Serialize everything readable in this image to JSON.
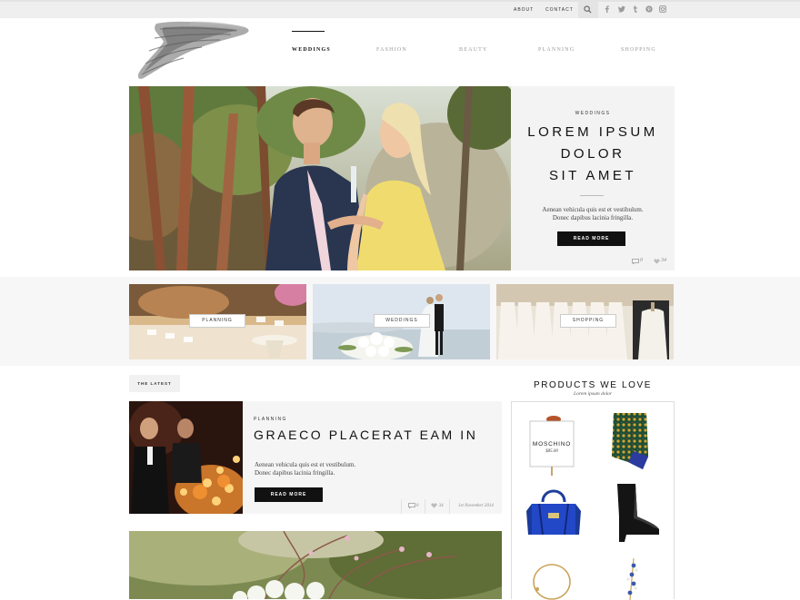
{
  "topbar": {
    "links": [
      "ABOUT",
      "CONTACT"
    ],
    "search_icon": "search-icon",
    "social_icons": [
      "facebook-icon",
      "twitter-icon",
      "tumblr-icon",
      "pinterest-icon",
      "instagram-icon"
    ]
  },
  "nav": {
    "items": [
      "WEDDINGS",
      "FASHION",
      "BEAUTY",
      "PLANNING",
      "SHOPPING"
    ],
    "active": "WEDDINGS"
  },
  "hero": {
    "kicker": "WEDDINGS",
    "title_lines": [
      "LOREM IPSUM",
      "DOLOR",
      "SIT AMET"
    ],
    "desc_lines": [
      "Aenean vehicula quis est et vestibulum.",
      "Donec dapibus lacinia fringilla."
    ],
    "button": "READ MORE",
    "comments": "0",
    "likes": "34"
  },
  "tiles": [
    "PLANNING",
    "WEDDINGS",
    "SHOPPING"
  ],
  "latest": {
    "tab": "THE LATEST",
    "post": {
      "kicker": "PLANNING",
      "title": "GRAECO PLACERAT EAM IN",
      "desc_lines": [
        "Aenean vehicula quis est et vestibulum.",
        "Donec dapibus lacinia fringilla."
      ],
      "button": "READ MORE",
      "comments": "0",
      "likes": "34",
      "date": "1st November 2014"
    }
  },
  "products": {
    "title": "PRODUCTS WE LOVE",
    "subtitle": "Lorem ipsum dolor",
    "items": [
      {
        "type": "tag",
        "brand": "MOSCHINO",
        "price": "$85.00"
      },
      {
        "type": "skirt"
      },
      {
        "type": "handbag"
      },
      {
        "type": "boot"
      },
      {
        "type": "bracelet"
      },
      {
        "type": "earring"
      }
    ]
  },
  "colors": {
    "accent": "#111111",
    "panel": "#f3f3f3",
    "band": "#f7f7f7"
  }
}
